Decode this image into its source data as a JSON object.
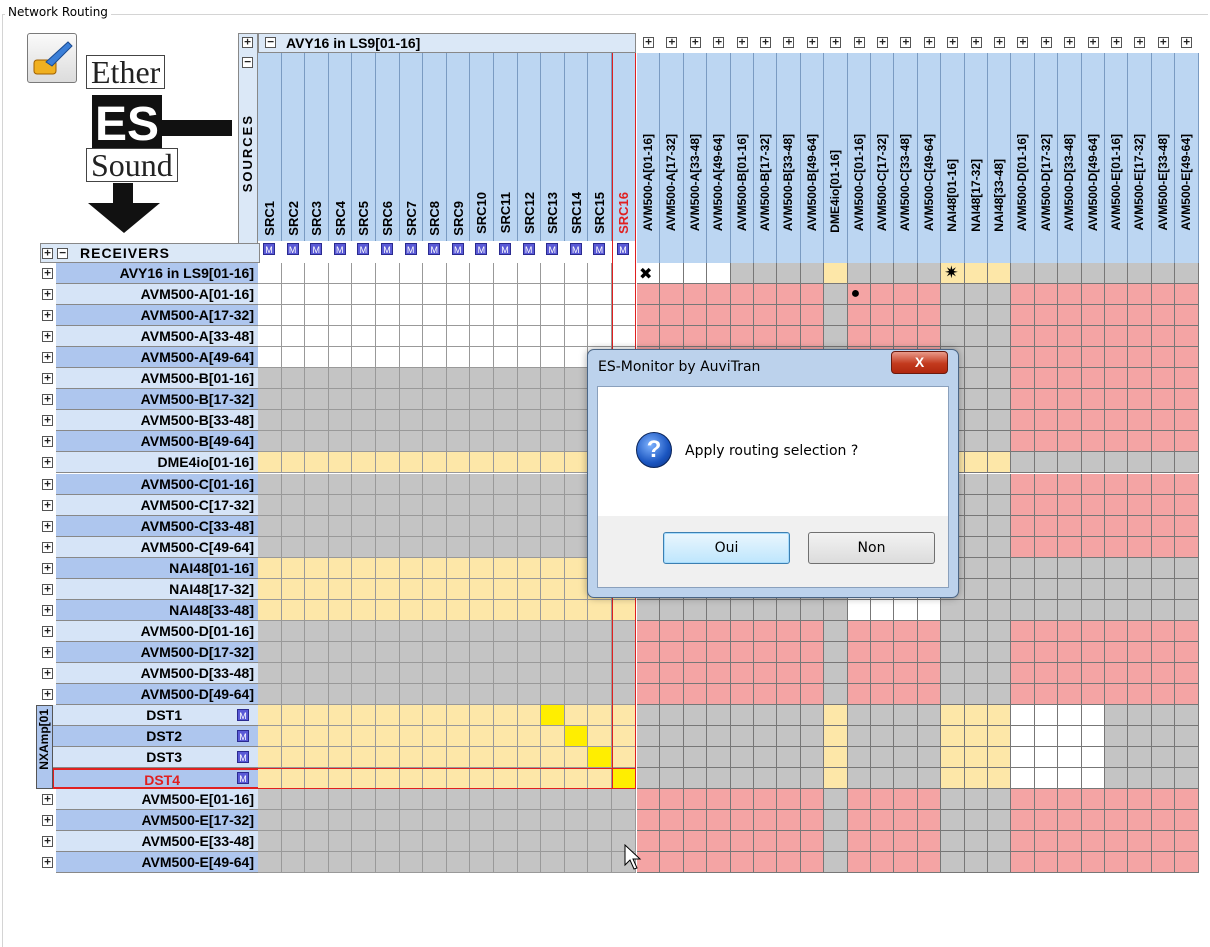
{
  "frame_title": "Network Routing",
  "logo": {
    "line1": "Ether",
    "mid": "ES",
    "line2": "Sound"
  },
  "sources_header": "SOURCES",
  "receivers_header": "RECEIVERS",
  "source_group_title": "AVY16 in LS9[01-16]",
  "src_labels": [
    "SRC1",
    "SRC2",
    "SRC3",
    "SRC4",
    "SRC5",
    "SRC6",
    "SRC7",
    "SRC8",
    "SRC9",
    "SRC10",
    "SRC11",
    "SRC12",
    "SRC13",
    "SRC14",
    "SRC15",
    "SRC16"
  ],
  "highlight_src_label": "SRC16",
  "m_label": "M",
  "plus_glyph": "+",
  "minus_glyph": "−",
  "other_sources": [
    "AVM500-A[01-16]",
    "AVM500-A[17-32]",
    "AVM500-A[33-48]",
    "AVM500-A[49-64]",
    "AVM500-B[01-16]",
    "AVM500-B[17-32]",
    "AVM500-B[33-48]",
    "AVM500-B[49-64]",
    "DME4io[01-16]",
    "AVM500-C[01-16]",
    "AVM500-C[17-32]",
    "AVM500-C[33-48]",
    "AVM500-C[49-64]",
    "NAI48[01-16]",
    "NAI48[17-32]",
    "NAI48[33-48]",
    "AVM500-D[01-16]",
    "AVM500-D[17-32]",
    "AVM500-D[33-48]",
    "AVM500-D[49-64]",
    "AVM500-E[01-16]",
    "AVM500-E[17-32]",
    "AVM500-E[33-48]",
    "AVM500-E[49-64]"
  ],
  "receivers_top": [
    "AVY16 in LS9[01-16]",
    "AVM500-A[01-16]",
    "AVM500-A[17-32]",
    "AVM500-A[33-48]",
    "AVM500-A[49-64]",
    "AVM500-B[01-16]",
    "AVM500-B[17-32]",
    "AVM500-B[33-48]",
    "AVM500-B[49-64]",
    "DME4io[01-16]",
    "AVM500-C[01-16]",
    "AVM500-C[17-32]",
    "AVM500-C[33-48]",
    "AVM500-C[49-64]",
    "NAI48[01-16]",
    "NAI48[17-32]",
    "NAI48[33-48]",
    "AVM500-D[01-16]",
    "AVM500-D[17-32]",
    "AVM500-D[33-48]",
    "AVM500-D[49-64]"
  ],
  "nxamp_group": "NXAmp[01",
  "nxamp_dsts": [
    "DST1",
    "DST2",
    "DST3",
    "DST4"
  ],
  "highlight_dst": "DST4",
  "receivers_bottom": [
    "AVM500-E[01-16]",
    "AVM500-E[17-32]",
    "AVM500-E[33-48]",
    "AVM500-E[49-64]"
  ],
  "matrix_markers": {
    "cross": "✖",
    "star": "✷",
    "dot": "●"
  },
  "dialog": {
    "title": "ES-Monitor by AuviTran",
    "close": "X",
    "message": "Apply routing selection ?",
    "yes": "Oui",
    "no": "Non",
    "icon": "question-icon"
  },
  "colors": {
    "pink": "#f4a4a4",
    "yellow_light": "#fde7a8",
    "yellow_active": "#ffee00",
    "grey": "#c4c4c4",
    "blue_header": "#bcd6f2",
    "row_blue": "#aec6ee",
    "highlight_red": "#e02020"
  }
}
